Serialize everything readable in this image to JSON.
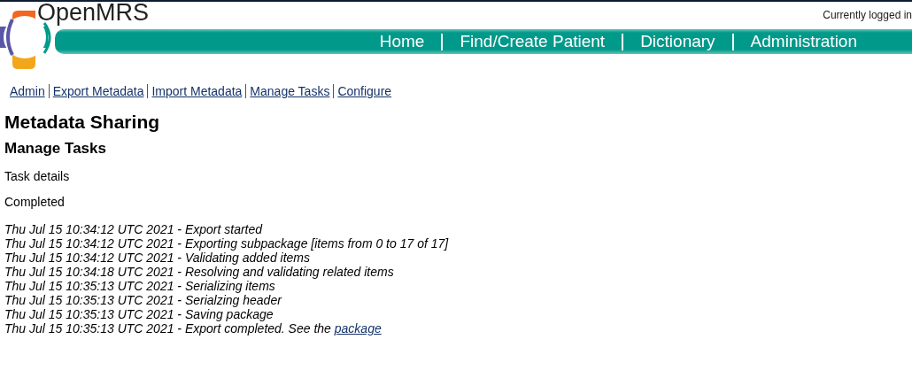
{
  "header": {
    "brand": "OpenMRS",
    "user_info": "Currently logged in",
    "nav": [
      "Home",
      "Find/Create Patient",
      "Dictionary",
      "Administration"
    ]
  },
  "subnav": [
    "Admin",
    "Export Metadata",
    "Import Metadata",
    "Manage Tasks",
    "Configure"
  ],
  "title": "Metadata Sharing",
  "subtitle": "Manage Tasks",
  "section": "Task details",
  "status": "Completed",
  "log": [
    {
      "text": "Thu Jul 15 10:34:12 UTC 2021 - Export started"
    },
    {
      "text": "Thu Jul 15 10:34:12 UTC 2021 - Exporting subpackage [items from 0 to 17 of 17]"
    },
    {
      "text": "Thu Jul 15 10:34:12 UTC 2021 - Validating added items"
    },
    {
      "text": "Thu Jul 15 10:34:18 UTC 2021 - Resolving and validating related items"
    },
    {
      "text": "Thu Jul 15 10:35:13 UTC 2021 - Serializing items"
    },
    {
      "text": "Thu Jul 15 10:35:13 UTC 2021 - Serialzing header"
    },
    {
      "text": "Thu Jul 15 10:35:13 UTC 2021 - Saving package"
    },
    {
      "text": "Thu Jul 15 10:35:13 UTC 2021 - Export completed. See the ",
      "link": "package"
    }
  ]
}
